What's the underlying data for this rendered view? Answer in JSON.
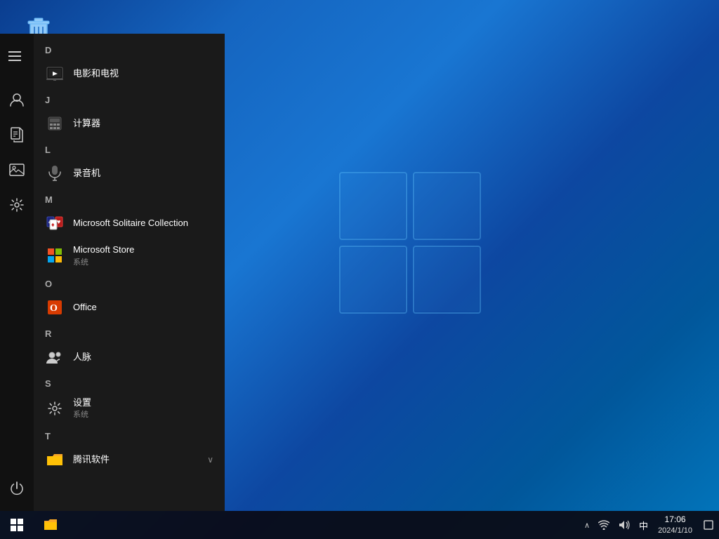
{
  "desktop": {
    "recycle_bin_label": "回收站"
  },
  "start_menu": {
    "sections": [
      {
        "letter": "D",
        "items": [
          {
            "id": "movies-tv",
            "name": "电影和电视",
            "icon": "film",
            "sub": ""
          }
        ]
      },
      {
        "letter": "J",
        "items": [
          {
            "id": "calculator",
            "name": "计算器",
            "icon": "calc",
            "sub": ""
          }
        ]
      },
      {
        "letter": "L",
        "items": [
          {
            "id": "recorder",
            "name": "录音机",
            "icon": "mic",
            "sub": ""
          }
        ]
      },
      {
        "letter": "M",
        "items": [
          {
            "id": "solitaire",
            "name": "Microsoft Solitaire Collection",
            "icon": "cards",
            "sub": ""
          },
          {
            "id": "msstore",
            "name": "Microsoft Store",
            "icon": "store",
            "sub": "系统"
          }
        ]
      },
      {
        "letter": "O",
        "items": [
          {
            "id": "office",
            "name": "Office",
            "icon": "office",
            "sub": ""
          }
        ]
      },
      {
        "letter": "R",
        "items": [
          {
            "id": "contacts",
            "name": "人脉",
            "icon": "people",
            "sub": ""
          }
        ]
      },
      {
        "letter": "S",
        "items": [
          {
            "id": "settings",
            "name": "设置",
            "icon": "gear",
            "sub": "系统"
          }
        ]
      },
      {
        "letter": "T",
        "items": [
          {
            "id": "tencent",
            "name": "腾讯软件",
            "icon": "folder",
            "sub": "",
            "expandable": true
          }
        ]
      }
    ],
    "sidebar_icons": [
      {
        "id": "user",
        "icon": "👤"
      },
      {
        "id": "document",
        "icon": "📄"
      },
      {
        "id": "pictures",
        "icon": "🖼️"
      },
      {
        "id": "settings",
        "icon": "⚙️"
      },
      {
        "id": "power",
        "icon": "⏻"
      }
    ]
  },
  "taskbar": {
    "start_label": "Start",
    "tray": {
      "up_arrow": "∧",
      "input_method": "中",
      "time": "17:06",
      "date": "2024/1/10",
      "notification_icon": "💬"
    }
  }
}
